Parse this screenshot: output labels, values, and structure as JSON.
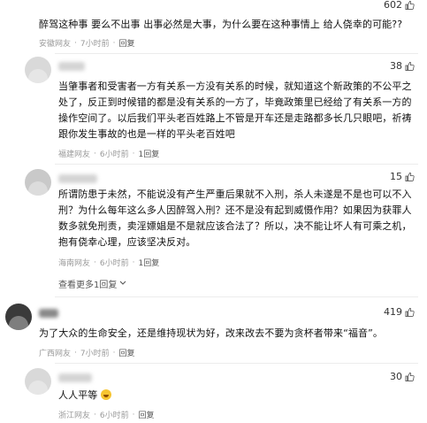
{
  "comments": [
    {
      "likes": "602",
      "text": "醉驾这种事 要么不出事 出事必然是大事，为什么要在这种事情上 给人侥幸的可能??",
      "location": "安徽网友",
      "time": "7小时前",
      "reply": "回复"
    },
    {
      "likes": "38",
      "text": "当肇事者和受害者一方有关系一方没有关系的时候，就知道这个新政策的不公平之处了，反正到时候错的都是没有关系的一方了，毕竟政策里已经给了有关系一方的操作空间了。以后我们平头老百姓路上不管是开车还是走路都多长几只眼吧，祈祷跟你发生事故的也是一样的平头老百姓吧",
      "location": "福建网友",
      "time": "6小时前",
      "reply": "1回复"
    },
    {
      "likes": "15",
      "text": "所谓防患于未然，不能说没有产生严重后果就不入刑，杀人未遂是不是也可以不入刑？为什么每年这么多人因醉驾入刑？还不是没有起到威慑作用？如果因为获罪人数多就免刑责，卖淫嫖娼是不是就应该合法了？所以，决不能让坏人有可乘之机，抱有侥幸心理，应该坚决反对。",
      "location": "海南网友",
      "time": "6小时前",
      "reply": "1回复",
      "more": "查看更多1回复"
    },
    {
      "likes": "419",
      "text": "为了大众的生命安全，还是维持现状为好，改来改去不要为贪杯者带来“福音”。",
      "location": "广西网友",
      "time": "7小时前",
      "reply": "回复"
    },
    {
      "likes": "30",
      "text": "人人平等",
      "location": "浙江网友",
      "time": "6小时前",
      "reply": "回复"
    }
  ],
  "icons": {
    "like": "thumbs-up-icon",
    "expand": "chevron-down-icon",
    "emoji": "grinning-face-emoji"
  }
}
